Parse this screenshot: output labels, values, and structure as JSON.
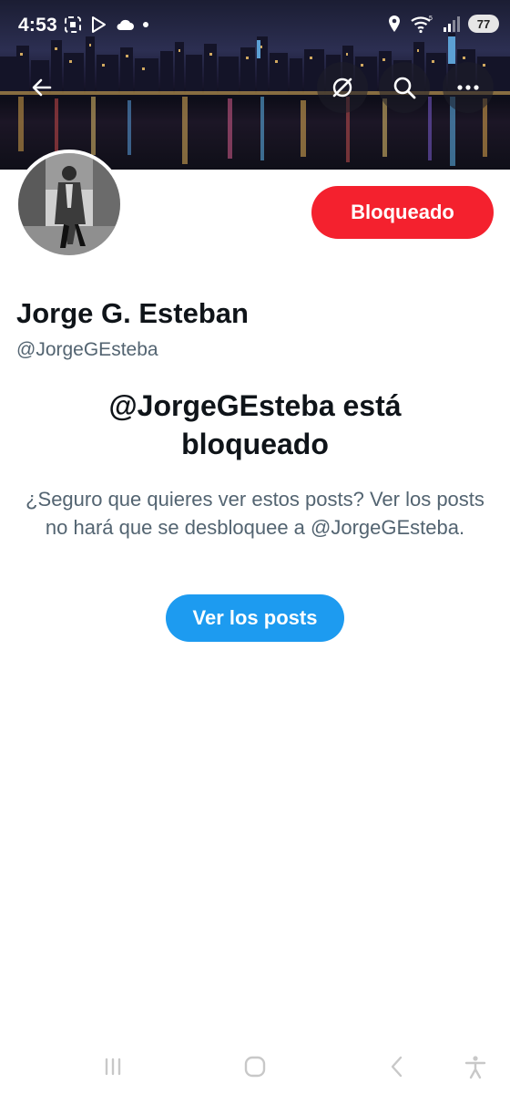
{
  "status_bar": {
    "time": "4:53",
    "battery": "77",
    "left_icons": [
      "screenshot-icon",
      "play-store-icon",
      "cloud-icon",
      "dot-icon"
    ],
    "right_icons": [
      "location-icon",
      "wifi-icon",
      "signal-icon",
      "battery-icon"
    ]
  },
  "top_nav": {
    "back_icon": "arrow-left-icon",
    "actions": [
      "grok-icon",
      "search-icon",
      "more-icon"
    ]
  },
  "profile": {
    "name": "Jorge G. Esteban",
    "handle": "@JorgeGEsteba",
    "blocked_button_label": "Bloqueado"
  },
  "blocked_notice": {
    "title": "@JorgeGEsteba está bloqueado",
    "description": "¿Seguro que quieres ver estos posts? Ver los posts no hará que se desbloquee a @JorgeGEsteba.",
    "view_button_label": "Ver los posts"
  },
  "colors": {
    "blocked_red": "#f4212e",
    "accent_blue": "#1d9bf0",
    "text_primary": "#0f1419",
    "text_secondary": "#536471"
  },
  "system_nav": [
    "recents-icon",
    "home-icon",
    "back-icon",
    "accessibility-icon"
  ]
}
